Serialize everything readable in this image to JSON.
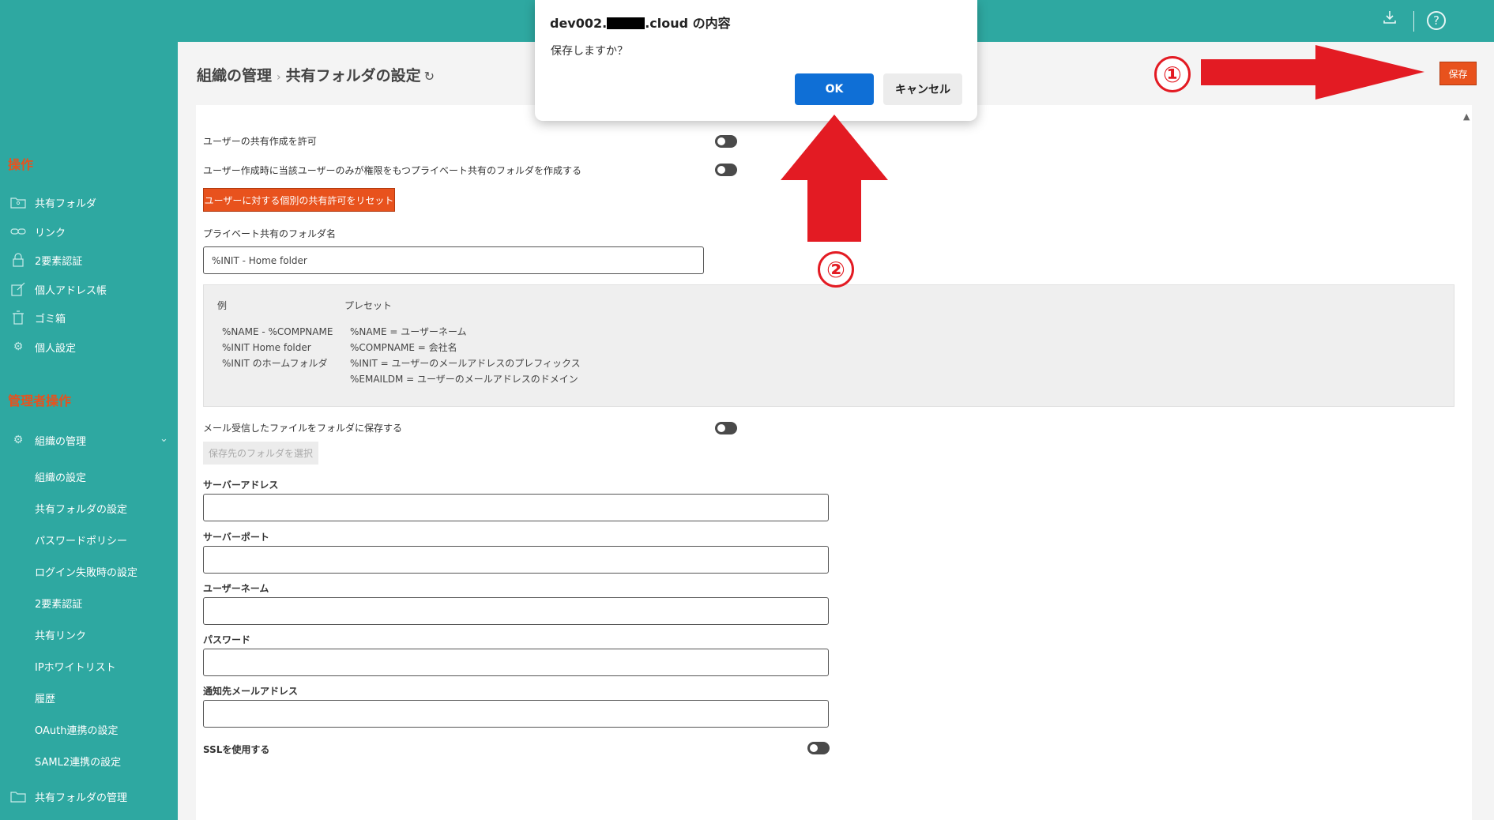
{
  "topbar": {
    "download_icon": "download-icon",
    "help_icon": "help-icon"
  },
  "sidebar": {
    "ops_title": "操作",
    "ops_items": [
      {
        "icon": "folder-user-icon",
        "label": "共有フォルダ"
      },
      {
        "icon": "link-icon",
        "label": "リンク"
      },
      {
        "icon": "lock-icon",
        "label": "2要素認証"
      },
      {
        "icon": "address-book-icon",
        "label": "個人アドレス帳"
      },
      {
        "icon": "trash-icon",
        "label": "ゴミ箱"
      },
      {
        "icon": "gear-icon",
        "label": "個人設定"
      }
    ],
    "admin_title": "管理者操作",
    "admin_group": {
      "icon": "gear-icon",
      "label": "組織の管理"
    },
    "admin_sub": [
      "組織の設定",
      "共有フォルダの設定",
      "パスワードポリシー",
      "ログイン失敗時の設定",
      "2要素認証",
      "共有リンク",
      "IPホワイトリスト",
      "履歴",
      "OAuth連携の設定",
      "SAML2連携の設定"
    ],
    "shared_mgmt": {
      "icon": "folder-icon",
      "label": "共有フォルダの管理"
    }
  },
  "header": {
    "crumb1": "組織の管理",
    "crumb2": "共有フォルダの設定",
    "save_label": "保存"
  },
  "form": {
    "allow_share_label": "ユーザーの共有作成を許可",
    "allow_share_on": false,
    "private_folder_label": "ユーザー作成時に当該ユーザーのみが権限をもつプライベート共有のフォルダを作成する",
    "private_folder_on": false,
    "reset_button": "ユーザーに対する個別の共有許可をリセット",
    "private_name_label": "プライベート共有のフォルダ名",
    "private_name_value": "%INIT - Home folder",
    "example_header": "例",
    "preset_header": "プレセット",
    "examples": [
      "%NAME - %COMPNAME",
      "%INIT Home folder",
      "%INIT のホームフォルダ"
    ],
    "presets": [
      "%NAME = ユーザーネーム",
      "%COMPNAME = 会社名",
      "%INIT = ユーザーのメールアドレスのプレフィックス",
      "%EMAILDM = ユーザーのメールアドレスのドメイン"
    ],
    "mail_save_label": "メール受信したファイルをフォルダに保存する",
    "mail_save_on": false,
    "select_folder_button": "保存先のフォルダを選択",
    "server_address_label": "サーバーアドレス",
    "server_port_label": "サーバーポート",
    "username_label": "ユーザーネーム",
    "password_label": "パスワード",
    "notify_email_label": "通知先メールアドレス",
    "ssl_label": "SSLを使用する",
    "ssl_on": false
  },
  "dialog": {
    "title_prefix": "dev002.",
    "title_suffix": ".cloud の内容",
    "message": "保存しますか？",
    "ok_label": "OK",
    "cancel_label": "キャンセル"
  },
  "annotations": {
    "step1": "①",
    "step2": "②",
    "color": "#e31b23"
  }
}
